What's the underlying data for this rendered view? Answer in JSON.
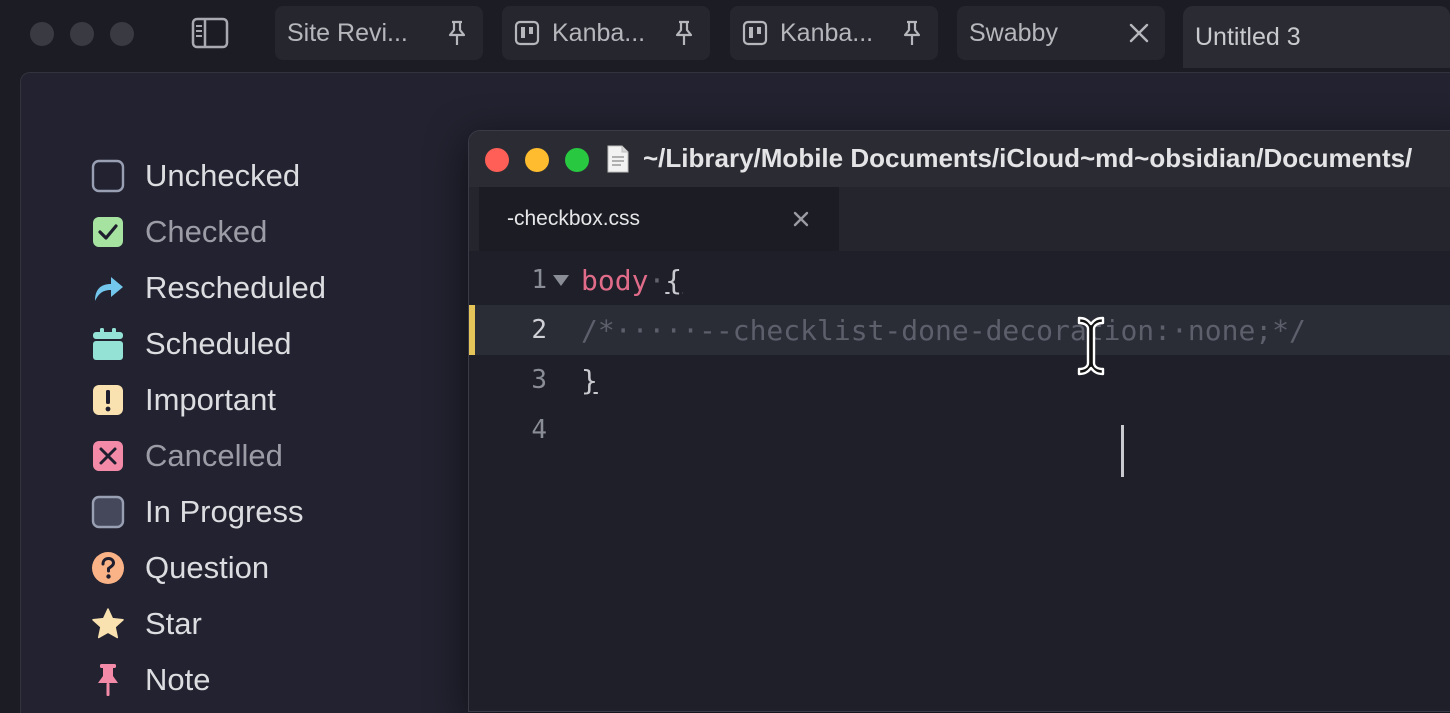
{
  "tabstrip": {
    "tabs": [
      {
        "label": "Site Revi...",
        "icon": "document-icon",
        "trail": "pin-icon"
      },
      {
        "label": "Kanba...",
        "icon": "kanban-icon",
        "trail": "pin-icon"
      },
      {
        "label": "Kanba...",
        "icon": "kanban-icon",
        "trail": "pin-icon"
      },
      {
        "label": "Swabby",
        "icon": "",
        "trail": "close-icon"
      },
      {
        "label": "Untitled 3",
        "icon": "",
        "trail": ""
      }
    ]
  },
  "legend": {
    "items": [
      {
        "label": "Unchecked",
        "icon": "checkbox-empty-icon",
        "color": "#9aa0b3",
        "muted": false
      },
      {
        "label": "Checked",
        "icon": "checkbox-checked-icon",
        "color": "#a6e3a1",
        "muted": true
      },
      {
        "label": "Rescheduled",
        "icon": "forward-arrow-icon",
        "color": "#74c7ec",
        "muted": false
      },
      {
        "label": "Scheduled",
        "icon": "calendar-icon",
        "color": "#94e2d5",
        "muted": false
      },
      {
        "label": "Important",
        "icon": "exclamation-icon",
        "color": "#f9e2af",
        "muted": false
      },
      {
        "label": "Cancelled",
        "icon": "cancelled-x-icon",
        "color": "#f38ba8",
        "muted": true
      },
      {
        "label": "In Progress",
        "icon": "in-progress-icon",
        "color": "#45475a",
        "muted": false
      },
      {
        "label": "Question",
        "icon": "question-icon",
        "color": "#fab387",
        "muted": false
      },
      {
        "label": "Star",
        "icon": "star-icon",
        "color": "#f9e2af",
        "muted": false
      },
      {
        "label": "Note",
        "icon": "pin-icon",
        "color": "#f38ba8",
        "muted": false
      }
    ]
  },
  "editor": {
    "path": "~/Library/Mobile Documents/iCloud~md~obsidian/Documents/",
    "tab_label": "-checkbox.css",
    "lines": [
      {
        "num": "1",
        "selector": "body",
        "ws": "·",
        "brace": "{"
      },
      {
        "num": "2",
        "comment": "/*·····--checklist-done-decoration:·none;*/"
      },
      {
        "num": "3",
        "brace": "}"
      },
      {
        "num": "4"
      }
    ]
  },
  "colors": {
    "background": "#1c1c24",
    "pane": "#222230",
    "editor_bg": "#1e1f28",
    "modified_marker": "#e5c45a",
    "css_selector": "#e06c8a",
    "comment": "#5d5f6b"
  }
}
